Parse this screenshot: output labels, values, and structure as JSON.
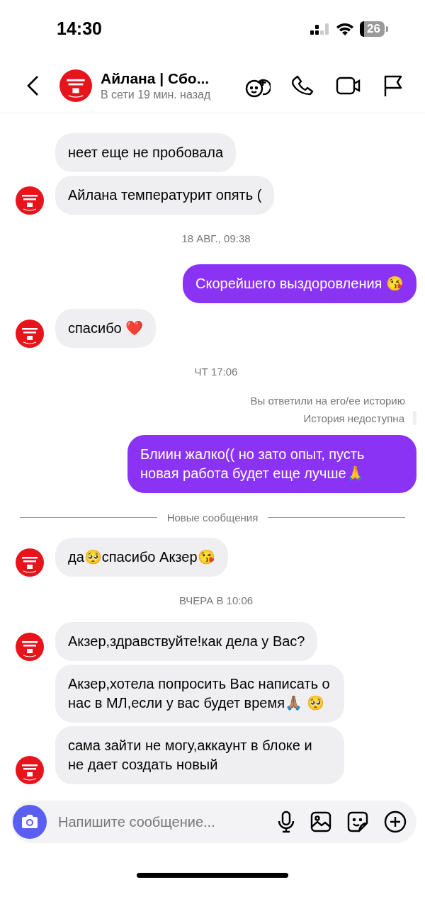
{
  "status_bar": {
    "time": "14:30",
    "battery": "26"
  },
  "header": {
    "name": "Айлана | Сбо...",
    "status": "В сети 19 мин. назад"
  },
  "messages": [
    {
      "kind": "in",
      "text": "неет еще не пробовала",
      "avatar": false
    },
    {
      "kind": "in",
      "text": "Айлана температурит опять (",
      "avatar": true
    },
    {
      "kind": "date",
      "text": "18 АВГ., 09:38"
    },
    {
      "kind": "out",
      "text": "Скорейшего выздоровления 😘"
    },
    {
      "kind": "in",
      "text": "спасибо ❤️",
      "avatar": true
    },
    {
      "kind": "date",
      "text": "ЧТ 17:06"
    },
    {
      "kind": "note",
      "text": "Вы ответили на его/ее историю"
    },
    {
      "kind": "story",
      "text": "История недоступна"
    },
    {
      "kind": "out",
      "text": "Блиин жалко(( но зато опыт, пусть новая работа будет еще лучше🙏"
    },
    {
      "kind": "divider",
      "text": "Новые сообщения"
    },
    {
      "kind": "in",
      "text": "да🥺спасибо Акзер😘",
      "avatar": true
    },
    {
      "kind": "date",
      "text": "ВЧЕРА В 10:06"
    },
    {
      "kind": "in",
      "text": "Акзер,здравствуйте!как дела у Вас?",
      "avatar": true
    },
    {
      "kind": "in",
      "text": "Акзер,хотела попросить Вас написать о нас в МЛ,если у вас будет время🙏🏽 🥺",
      "avatar": false
    },
    {
      "kind": "in",
      "text": "сама зайти не могу,аккаунт в блоке и не дает создать новый",
      "avatar": true
    }
  ],
  "composer": {
    "placeholder": "Напишите сообщение..."
  }
}
